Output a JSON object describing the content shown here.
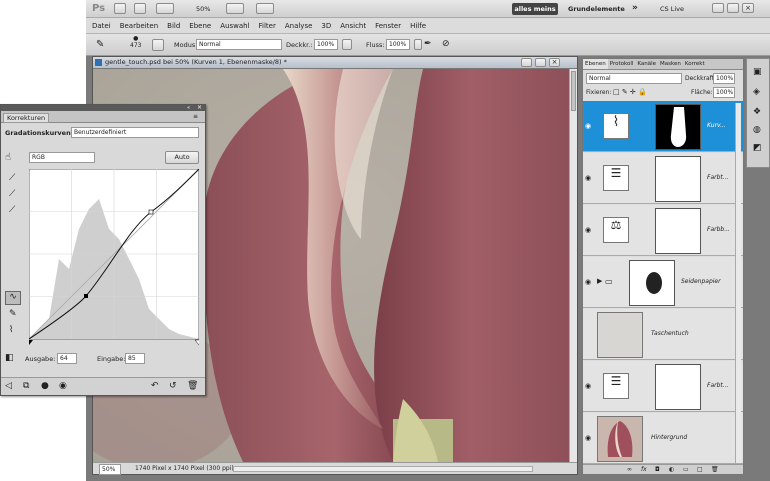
{
  "app": {
    "logo": "Ps",
    "zoom": "50%",
    "workspace_button": "alles meins",
    "workspace_name": "Grundelemente",
    "more": "»",
    "cslive": "CS Live"
  },
  "menu": [
    "Datei",
    "Bearbeiten",
    "Bild",
    "Ebene",
    "Auswahl",
    "Filter",
    "Analyse",
    "3D",
    "Ansicht",
    "Fenster",
    "Hilfe"
  ],
  "options": {
    "brush_size": "473",
    "mode_label": "Modus:",
    "mode_value": "Normal",
    "opacity_label": "Deckkr.:",
    "opacity_value": "100%",
    "flow_label": "Fluss:",
    "flow_value": "100%"
  },
  "document": {
    "title": "gentle_touch.psd bei 50% (Kurven 1, Ebenenmaske/8) *",
    "status_zoom": "50%",
    "status_info": "1740 Pixel x 1740 Pixel (300 ppi)"
  },
  "layers_panel": {
    "tabs": [
      "Ebenen",
      "Protokoll",
      "Kanäle",
      "Masken",
      "Korrekt",
      "Pfade"
    ],
    "blend_mode": "Normal",
    "opacity_label": "Deckkraft:",
    "opacity_value": "100%",
    "lock_label": "Fixieren:",
    "fill_label": "Fläche:",
    "fill_value": "100%",
    "layers": [
      {
        "name": "Kurv...",
        "selected": true,
        "type": "curves"
      },
      {
        "name": "Farbt...",
        "selected": false,
        "type": "huesat"
      },
      {
        "name": "Farbb...",
        "selected": false,
        "type": "balance"
      },
      {
        "name": "Seidenpapier",
        "selected": false,
        "type": "group"
      },
      {
        "name": "Taschentuch",
        "selected": false,
        "type": "texture"
      },
      {
        "name": "Farbt...",
        "selected": false,
        "type": "huesat"
      },
      {
        "name": "Hintergrund",
        "selected": false,
        "type": "photo"
      }
    ],
    "footer": "fx"
  },
  "korrekturen": {
    "tab": "Korrekturen",
    "title": "Gradationskurven",
    "preset": "Benutzerdefiniert",
    "channel": "RGB",
    "auto_label": "Auto",
    "output_label": "Ausgabe:",
    "output_value": "64",
    "input_label": "Eingabe:",
    "input_value": "85"
  }
}
